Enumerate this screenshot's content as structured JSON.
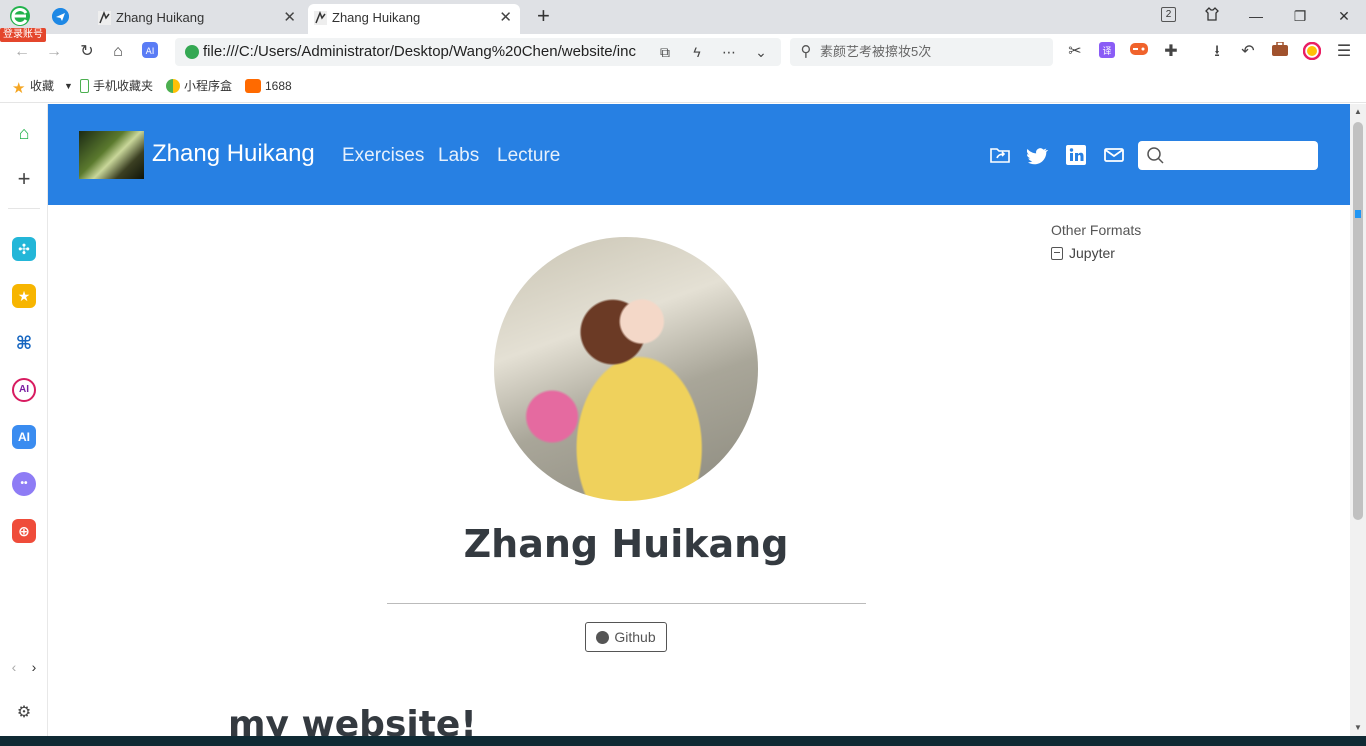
{
  "browser": {
    "login_badge": "登录账号",
    "tabs": [
      {
        "title": "Zhang Huikang",
        "active": false
      },
      {
        "title": "Zhang Huikang",
        "active": true
      }
    ],
    "new_tab": "+",
    "tab_count": "2",
    "address": "file:///C:/Users/Administrator/Desktop/Wang%20Chen/website/inc",
    "search_placeholder": "素颜艺考被擦妆5次",
    "bookmarks": [
      "收藏",
      "手机收藏夹",
      "小程序盒",
      "1688"
    ],
    "accent": "#2780e3"
  },
  "site": {
    "title": "Zhang Huikang",
    "nav": [
      "Exercises",
      "Labs",
      "Lecture"
    ],
    "nav_icons": [
      "folder-share-icon",
      "twitter-icon",
      "linkedin-icon",
      "mail-icon"
    ],
    "search_placeholder": ""
  },
  "toc": {
    "title": "Other Formats",
    "link": "Jupyter"
  },
  "profile": {
    "name": "Zhang Huikang",
    "github": "Github"
  },
  "content": {
    "heading": "my website!"
  }
}
